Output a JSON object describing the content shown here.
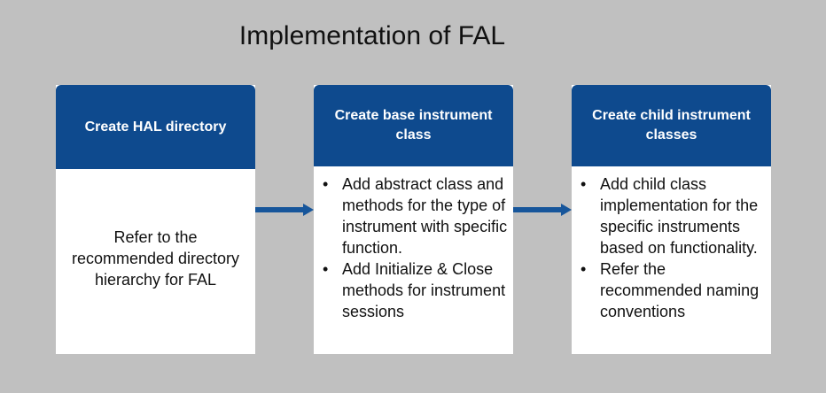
{
  "title": "Implementation of FAL",
  "steps": [
    {
      "header": "Create HAL directory",
      "body": "Refer to the recommended directory hierarchy for FAL"
    },
    {
      "header": "Create base instrument class",
      "bullets": [
        "Add abstract class and methods for the type of instrument with specific function.",
        "Add Initialize & Close methods for instrument sessions"
      ]
    },
    {
      "header": "Create child instrument classes",
      "bullets": [
        "Add child class implementation for the specific instruments based on functionality.",
        "Refer the recommended naming conventions"
      ]
    }
  ],
  "colors": {
    "header_blue": "#0e4a8e",
    "arrow_blue": "#17569b",
    "background": "#c0c0c0"
  }
}
